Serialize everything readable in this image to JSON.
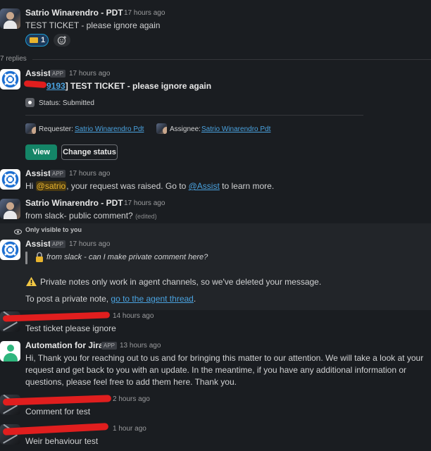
{
  "messages": {
    "m1": {
      "name": "Satrio Winarendro - PDT",
      "time": "17 hours ago",
      "text": "TEST TICKET - please ignore again",
      "reaction_count": "1"
    },
    "replies_count": "7 replies",
    "m2": {
      "name": "Assist",
      "badge": "APP",
      "time": "17 hours ago",
      "ticket_id": "9193",
      "ticket_title": "] TEST TICKET - please ignore again",
      "status": "Status: Submitted",
      "requester_label": "Requester:",
      "requester_name": "Satrio Winarendro Pdt",
      "assignee_label": "Assignee:",
      "assignee_name": "Satrio Winarendro Pdt",
      "view_label": "View",
      "change_status_label": "Change status"
    },
    "m3": {
      "name": "Assist",
      "badge": "APP",
      "time": "17 hours ago",
      "text_pre": "Hi ",
      "mention": "@satrio",
      "text_mid": ", your request was raised. Go to ",
      "link": "@Assist",
      "text_post": " to learn more."
    },
    "m4": {
      "name": "Satrio Winarendro - PDT",
      "time": "17 hours ago",
      "text": "from slack- public comment?",
      "edited": "(edited)"
    },
    "visibility": "Only visible to you",
    "m5": {
      "name": "Assist",
      "badge": "APP",
      "time": "17 hours ago",
      "quote": "from slack - can I make private comment here?",
      "warning": "Private notes only work in agent channels, so we've deleted your message.",
      "private_pre": "To post a private note, ",
      "private_link": "go to the agent thread",
      "private_post": "."
    },
    "m6": {
      "time": "14 hours ago",
      "text": "Test ticket please ignore"
    },
    "m7": {
      "name": "Automation for Jira",
      "badge": "APP",
      "time": "13 hours ago",
      "line1": "Hi, Thank you for reaching out to us and for bringing this matter to our attention. We will take a look at your",
      "line2": "request and get back to you with an update. In the meantime, if you have any additional information or",
      "line3": "questions, please feel free to add them here. Thank you."
    },
    "m8": {
      "time": "2 hours ago",
      "text": "Comment for test"
    },
    "m9": {
      "time": "1 hour ago",
      "text": "Weir behaviour test"
    }
  },
  "colors": {
    "background": "#1a1d21",
    "link": "#4aa2df",
    "view_button": "#148567",
    "redaction": "#e01e1e"
  }
}
